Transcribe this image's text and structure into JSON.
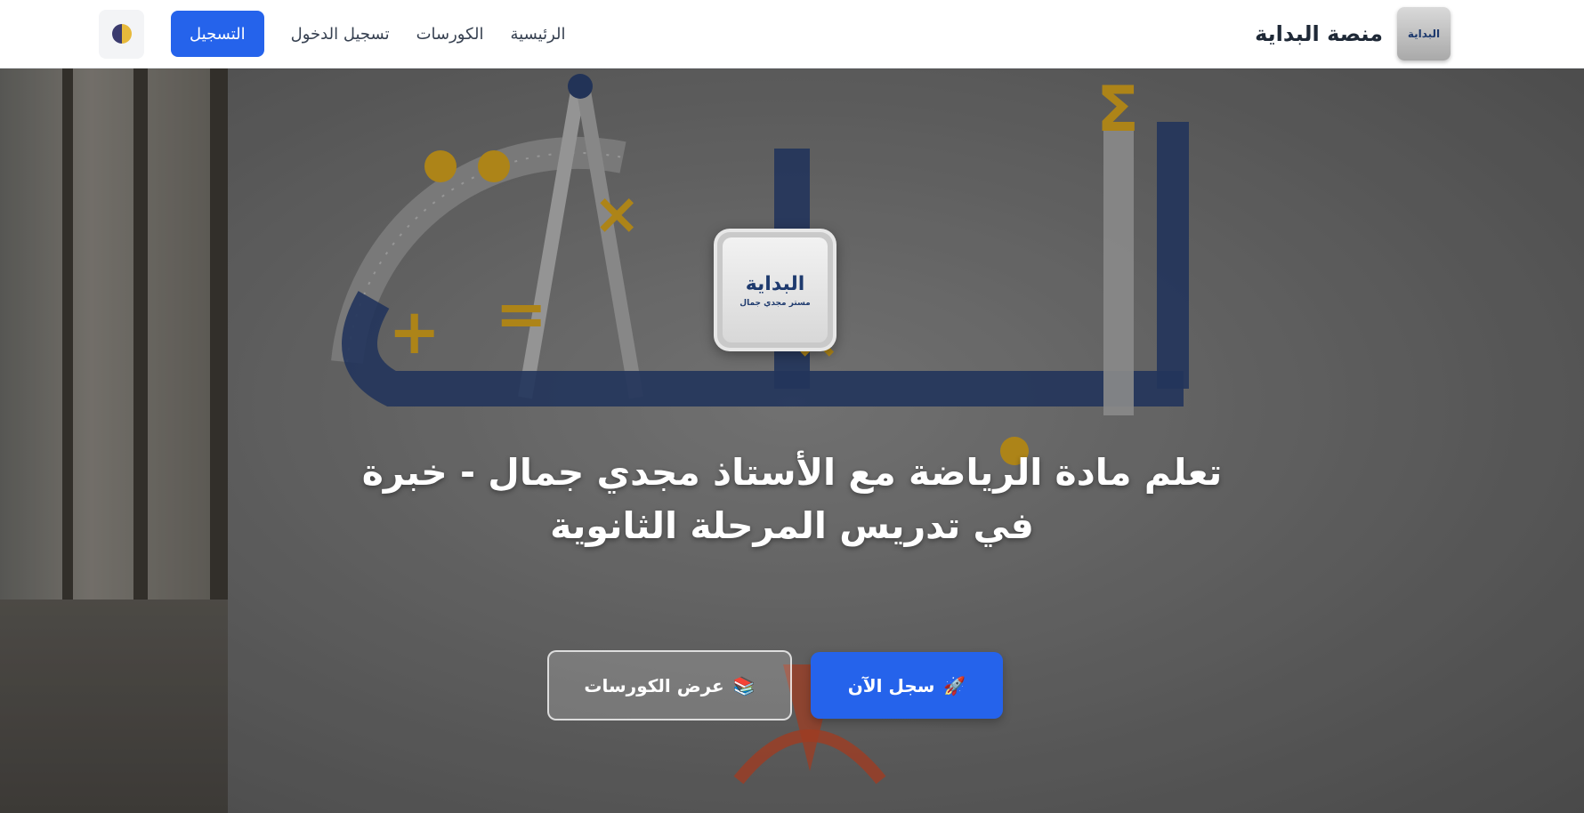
{
  "brand": {
    "name": "منصة البداية",
    "logo_text": "البداية"
  },
  "nav": {
    "links": [
      "الرئيسية",
      "الكورسات",
      "تسجيل الدخول"
    ],
    "register_label": "التسجيل",
    "theme_toggle_icon": "theme-toggle-icon"
  },
  "hero": {
    "logo_text": "البداية",
    "logo_subtext": "مستر مجدي جمال",
    "title_line1": "تعلم مادة الرياضة مع الأستاذ مجدي جمال - خبرة",
    "title_line2": "في تدريس المرحلة الثانوية",
    "primary_cta": {
      "icon": "rocket-icon",
      "glyph": "🚀",
      "label": "سجل الآن"
    },
    "secondary_cta": {
      "icon": "books-icon",
      "glyph": "📚",
      "label": "عرض الكورسات"
    }
  },
  "colors": {
    "accent": "#2563eb",
    "gold": "#d4a21e",
    "navy": "#1e3a6e"
  }
}
